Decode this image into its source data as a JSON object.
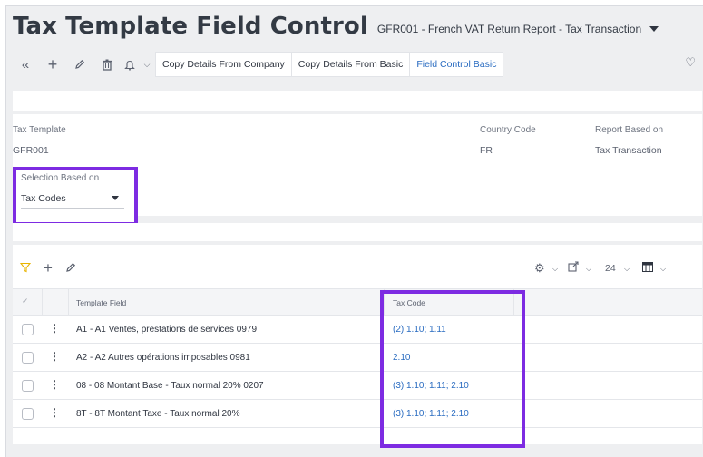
{
  "header": {
    "title": "Tax Template Field Control",
    "subtitle": "GFR001 - French VAT Return Report - Tax Transaction"
  },
  "toolbar": {
    "icons": [
      "collapse-icon",
      "plus-icon",
      "pencil-icon",
      "trash-icon",
      "bell-icon",
      "chevron-down-icon"
    ],
    "buttons": {
      "copy_company": "Copy Details From Company",
      "copy_basic": "Copy Details From Basic",
      "field_control_basic": "Field Control Basic"
    }
  },
  "details": {
    "tax_template_label": "Tax Template",
    "tax_template_value": "GFR001",
    "country_code_label": "Country Code",
    "country_code_value": "FR",
    "report_based_label": "Report Based on",
    "report_based_value": "Tax Transaction",
    "selection_label": "Selection Based on",
    "selection_value": "Tax Codes"
  },
  "grid": {
    "page_size": "24",
    "columns": {
      "template_field": "Template Field",
      "tax_code": "Tax Code"
    },
    "rows": [
      {
        "template_field": "A1 - A1 Ventes, prestations de services 0979",
        "tax_code": "(2) 1.10; 1.11"
      },
      {
        "template_field": "A2 - A2 Autres opérations imposables 0981",
        "tax_code": "2.10"
      },
      {
        "template_field": "08 - 08 Montant Base - Taux normal 20% 0207",
        "tax_code": "(3) 1.10; 1.11; 2.10"
      },
      {
        "template_field": "8T - 8T Montant Taxe - Taux normal 20%",
        "tax_code": "(3) 1.10; 1.11; 2.10"
      }
    ]
  },
  "colors": {
    "highlight": "#7d2be2",
    "link": "#2a6cc1",
    "filter": "#e8b400"
  }
}
